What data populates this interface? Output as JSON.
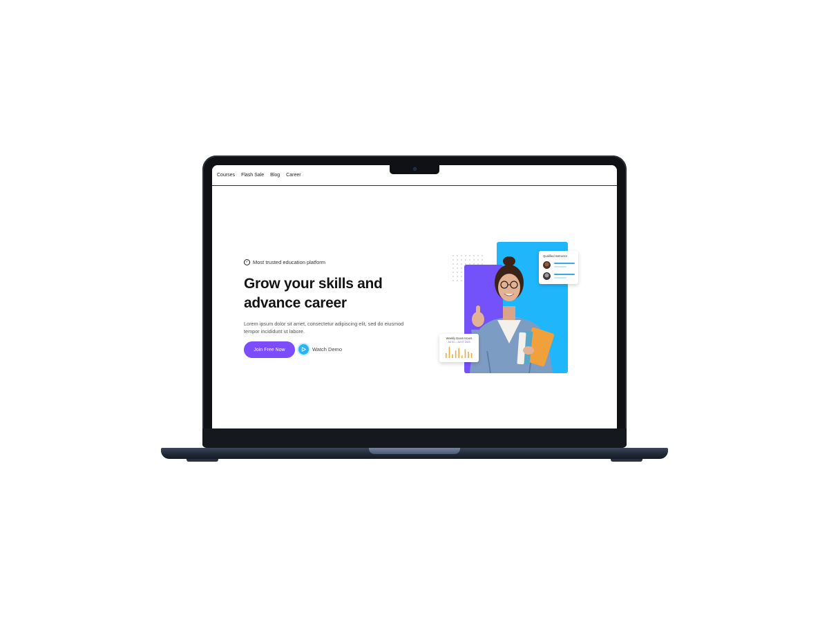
{
  "nav": {
    "items": [
      "Courses",
      "Flash Sale",
      "Blog",
      "Career"
    ]
  },
  "hero": {
    "badge": "Most trusted education platform",
    "title_line1": "Grow your skills and",
    "title_line2": "advance career",
    "description": "Lorem ipsum dolor sit amet, consectetur adipiscing elit, sed do eiusmod tempor incididunt ut labore.",
    "primary_button": "Join Free Now",
    "secondary_button": "Watch Demo"
  },
  "cards": {
    "instructor_title": "Qualified Instructor",
    "hours_title": "Weekly Exam Hours",
    "hours_subtitle": "Jul 01 – Jul 07 2023",
    "hours_bars": [
      0.4,
      0.9,
      0.3,
      0.6,
      0.8,
      0.2,
      0.7,
      0.5,
      0.4
    ]
  },
  "colors": {
    "primary": "#7b4dff",
    "accent_blue": "#1fb6fb",
    "panel_purple": "#7352fb"
  }
}
